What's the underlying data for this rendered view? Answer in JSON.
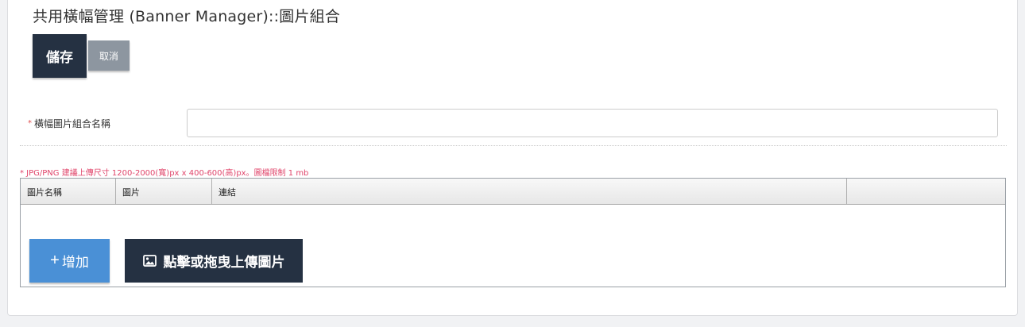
{
  "page": {
    "title": "共用橫幅管理 (Banner Manager)::圖片組合"
  },
  "toolbar": {
    "save_label": "儲存",
    "cancel_label": "取消"
  },
  "form": {
    "required_mark": "*",
    "name_label": "橫幅圖片組合名稱",
    "name_value": ""
  },
  "upload_hint": "* JPG/PNG 建議上傳尺寸 1200-2000(寬)px x 400-600(高)px。圖檔限制 1 mb",
  "grid": {
    "columns": [
      "圖片名稱",
      "圖片",
      "連結",
      ""
    ],
    "rows": []
  },
  "actions": {
    "add_label": "增加",
    "add_icon": "plus-icon",
    "upload_label": "點擊或拖曳上傳圖片",
    "upload_icon": "image-icon"
  },
  "colors": {
    "primary_dark": "#253142",
    "secondary_gray": "#8d96a0",
    "accent_blue": "#4a90d6",
    "hint_red": "#e0446a"
  }
}
